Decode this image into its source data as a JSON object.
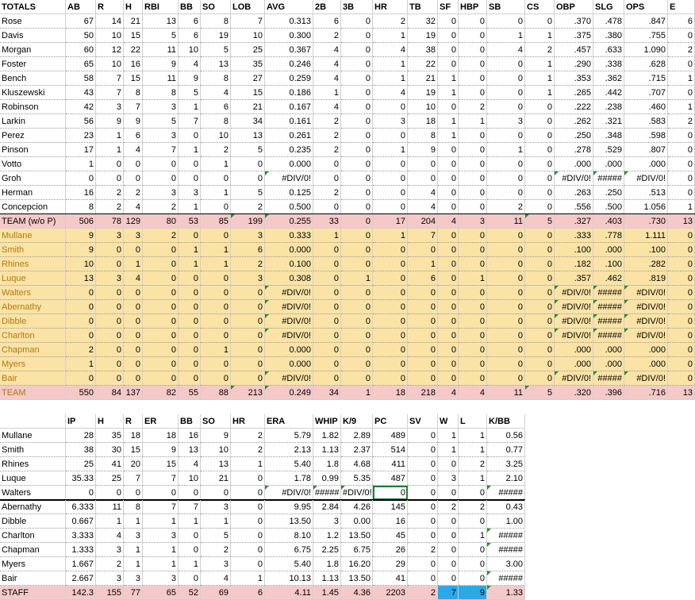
{
  "colors": {
    "team_row": "#f6c9c9",
    "pitcher_row": "#fbe3a6",
    "pitcher_name": "#b07a12",
    "highlight_blue": "#2aa9ea",
    "error_marker": "#2e8b2e"
  },
  "batting": {
    "headers": [
      "TOTALS",
      "AB",
      "R",
      "H",
      "RBI",
      "BB",
      "SO",
      "LOB",
      "AVG",
      "2B",
      "3B",
      "HR",
      "TB",
      "SF",
      "HBP",
      "SB",
      "CS",
      "OBP",
      "SLG",
      "OPS",
      "E"
    ],
    "rows": [
      [
        "Rose",
        "67",
        "14",
        "21",
        "13",
        "6",
        "8",
        "7",
        "0.313",
        "6",
        "0",
        "2",
        "32",
        "0",
        "0",
        "0",
        "0",
        ".370",
        ".478",
        ".847",
        "6"
      ],
      [
        "Davis",
        "50",
        "10",
        "15",
        "5",
        "6",
        "19",
        "10",
        "0.300",
        "2",
        "0",
        "1",
        "19",
        "0",
        "0",
        "1",
        "1",
        ".375",
        ".380",
        ".755",
        "0"
      ],
      [
        "Morgan",
        "60",
        "12",
        "22",
        "11",
        "10",
        "5",
        "25",
        "0.367",
        "4",
        "0",
        "4",
        "38",
        "0",
        "0",
        "4",
        "2",
        ".457",
        ".633",
        "1.090",
        "2"
      ],
      [
        "Foster",
        "65",
        "10",
        "16",
        "9",
        "4",
        "13",
        "35",
        "0.246",
        "4",
        "0",
        "1",
        "22",
        "0",
        "0",
        "0",
        "1",
        ".290",
        ".338",
        ".628",
        "0"
      ],
      [
        "Bench",
        "58",
        "7",
        "15",
        "11",
        "9",
        "8",
        "27",
        "0.259",
        "4",
        "0",
        "1",
        "21",
        "1",
        "0",
        "0",
        "1",
        ".353",
        ".362",
        ".715",
        "1"
      ],
      [
        "Kluszewski",
        "43",
        "7",
        "8",
        "8",
        "5",
        "4",
        "15",
        "0.186",
        "1",
        "0",
        "4",
        "19",
        "1",
        "0",
        "0",
        "1",
        ".265",
        ".442",
        ".707",
        "0"
      ],
      [
        "Robinson",
        "42",
        "3",
        "7",
        "3",
        "1",
        "6",
        "21",
        "0.167",
        "4",
        "0",
        "0",
        "10",
        "0",
        "2",
        "0",
        "0",
        ".222",
        ".238",
        ".460",
        "1"
      ],
      [
        "Larkin",
        "56",
        "9",
        "9",
        "5",
        "7",
        "8",
        "34",
        "0.161",
        "2",
        "0",
        "3",
        "18",
        "1",
        "1",
        "3",
        "0",
        ".262",
        ".321",
        ".583",
        "2"
      ],
      [
        "Perez",
        "23",
        "1",
        "6",
        "3",
        "0",
        "10",
        "13",
        "0.261",
        "2",
        "0",
        "0",
        "8",
        "1",
        "0",
        "0",
        "0",
        ".250",
        ".348",
        ".598",
        "0"
      ],
      [
        "Pinson",
        "17",
        "1",
        "4",
        "7",
        "1",
        "2",
        "5",
        "0.235",
        "2",
        "0",
        "1",
        "9",
        "0",
        "0",
        "1",
        "0",
        ".278",
        ".529",
        ".807",
        "0"
      ],
      [
        "Votto",
        "1",
        "0",
        "0",
        "0",
        "0",
        "1",
        "0",
        "0.000",
        "0",
        "0",
        "0",
        "0",
        "0",
        "0",
        "0",
        "0",
        ".000",
        ".000",
        ".000",
        "0"
      ],
      [
        "Groh",
        "0",
        "0",
        "0",
        "0",
        "0",
        "0",
        "0",
        "#DIV/0!",
        "0",
        "0",
        "0",
        "0",
        "0",
        "0",
        "0",
        "0",
        "#DIV/0!",
        "#####",
        "#DIV/0!",
        "0"
      ],
      [
        "Herman",
        "16",
        "2",
        "2",
        "3",
        "3",
        "1",
        "5",
        "0.125",
        "2",
        "0",
        "0",
        "4",
        "0",
        "0",
        "0",
        "0",
        ".263",
        ".250",
        ".513",
        "0"
      ],
      [
        "Concepcion",
        "8",
        "2",
        "4",
        "2",
        "1",
        "0",
        "2",
        "0.500",
        "0",
        "0",
        "0",
        "4",
        "0",
        "0",
        "2",
        "0",
        ".556",
        ".500",
        "1.056",
        "1"
      ]
    ],
    "team_row": [
      "TEAM (w/o P)",
      "506",
      "78",
      "129",
      "80",
      "53",
      "85",
      "199",
      "0.255",
      "33",
      "0",
      "17",
      "204",
      "4",
      "3",
      "11",
      "5",
      ".327",
      ".403",
      ".730",
      "13"
    ],
    "pitcher_rows": [
      [
        "Mullane",
        "9",
        "3",
        "3",
        "2",
        "0",
        "0",
        "3",
        "0.333",
        "1",
        "0",
        "1",
        "7",
        "0",
        "0",
        "0",
        "0",
        ".333",
        ".778",
        "1.111",
        "0"
      ],
      [
        "Smith",
        "9",
        "0",
        "0",
        "0",
        "1",
        "1",
        "6",
        "0.000",
        "0",
        "0",
        "0",
        "0",
        "0",
        "0",
        "0",
        "0",
        ".100",
        ".000",
        ".100",
        "0"
      ],
      [
        "Rhines",
        "10",
        "0",
        "1",
        "0",
        "1",
        "1",
        "2",
        "0.100",
        "0",
        "0",
        "0",
        "1",
        "0",
        "0",
        "0",
        "0",
        ".182",
        ".100",
        ".282",
        "0"
      ],
      [
        "Luque",
        "13",
        "3",
        "4",
        "0",
        "0",
        "0",
        "3",
        "0.308",
        "0",
        "1",
        "0",
        "6",
        "0",
        "1",
        "0",
        "0",
        ".357",
        ".462",
        ".819",
        "0"
      ],
      [
        "Walters",
        "0",
        "0",
        "0",
        "0",
        "0",
        "0",
        "0",
        "#DIV/0!",
        "0",
        "0",
        "0",
        "0",
        "0",
        "0",
        "0",
        "0",
        "#DIV/0!",
        "#####",
        "#DIV/0!",
        "0"
      ],
      [
        "Abernathy",
        "0",
        "0",
        "0",
        "0",
        "0",
        "0",
        "0",
        "#DIV/0!",
        "0",
        "0",
        "0",
        "0",
        "0",
        "0",
        "0",
        "0",
        "#DIV/0!",
        "#####",
        "#DIV/0!",
        "0"
      ],
      [
        "Dibble",
        "0",
        "0",
        "0",
        "0",
        "0",
        "0",
        "0",
        "#DIV/0!",
        "0",
        "0",
        "0",
        "0",
        "0",
        "0",
        "0",
        "0",
        "#DIV/0!",
        "#####",
        "#DIV/0!",
        "0"
      ],
      [
        "Charlton",
        "0",
        "0",
        "0",
        "0",
        "0",
        "0",
        "0",
        "#DIV/0!",
        "0",
        "0",
        "0",
        "0",
        "0",
        "0",
        "0",
        "0",
        "#DIV/0!",
        "#####",
        "#DIV/0!",
        "0"
      ],
      [
        "Chapman",
        "2",
        "0",
        "0",
        "0",
        "0",
        "1",
        "0",
        "0.000",
        "0",
        "0",
        "0",
        "0",
        "0",
        "0",
        "0",
        "0",
        ".000",
        ".000",
        ".000",
        "0"
      ],
      [
        "Myers",
        "1",
        "0",
        "0",
        "0",
        "0",
        "0",
        "0",
        "0.000",
        "0",
        "0",
        "0",
        "0",
        "0",
        "0",
        "0",
        "0",
        ".000",
        ".000",
        ".000",
        "0"
      ],
      [
        "Bair",
        "0",
        "0",
        "0",
        "0",
        "0",
        "0",
        "0",
        "#DIV/0!",
        "0",
        "0",
        "0",
        "0",
        "0",
        "0",
        "0",
        "0",
        "#DIV/0!",
        "#####",
        "#DIV/0!",
        "0"
      ]
    ],
    "total_row": [
      "TEAM",
      "550",
      "84",
      "137",
      "82",
      "55",
      "88",
      "213",
      "0.249",
      "34",
      "1",
      "18",
      "218",
      "4",
      "4",
      "11",
      "5",
      ".320",
      ".396",
      ".716",
      "13"
    ]
  },
  "pitching": {
    "headers": [
      "",
      "IP",
      "H",
      "R",
      "ER",
      "BB",
      "SO",
      "HR",
      "ERA",
      "WHIP",
      "K/9",
      "PC",
      "SV",
      "W",
      "L",
      "K/BB"
    ],
    "starters": [
      [
        "Mullane",
        "28",
        "35",
        "18",
        "18",
        "16",
        "9",
        "2",
        "5.79",
        "1.82",
        "2.89",
        "489",
        "0",
        "1",
        "1",
        "0.56"
      ],
      [
        "Smith",
        "38",
        "30",
        "15",
        "9",
        "13",
        "10",
        "2",
        "2.13",
        "1.13",
        "2.37",
        "514",
        "0",
        "1",
        "1",
        "0.77"
      ],
      [
        "Rhines",
        "25",
        "41",
        "20",
        "15",
        "4",
        "13",
        "1",
        "5.40",
        "1.8",
        "4.68",
        "411",
        "0",
        "0",
        "2",
        "3.25"
      ],
      [
        "Luque",
        "35.33",
        "25",
        "7",
        "7",
        "10",
        "21",
        "0",
        "1.78",
        "0.99",
        "5.35",
        "487",
        "0",
        "3",
        "1",
        "2.10"
      ],
      [
        "Walters",
        "0",
        "0",
        "0",
        "0",
        "0",
        "0",
        "0",
        "#DIV/0!",
        "#####",
        "#DIV/0!",
        "0",
        "0",
        "0",
        "0",
        "#####"
      ]
    ],
    "relievers": [
      [
        "Abernathy",
        "6.333",
        "11",
        "8",
        "7",
        "7",
        "3",
        "0",
        "9.95",
        "2.84",
        "4.26",
        "145",
        "0",
        "2",
        "2",
        "0.43"
      ],
      [
        "Dibble",
        "0.667",
        "1",
        "1",
        "1",
        "1",
        "1",
        "0",
        "13.50",
        "3",
        "0.00",
        "16",
        "0",
        "0",
        "0",
        "1.00"
      ],
      [
        "Charlton",
        "3.333",
        "4",
        "3",
        "3",
        "0",
        "5",
        "0",
        "8.10",
        "1.2",
        "13.50",
        "45",
        "0",
        "0",
        "1",
        "#####"
      ],
      [
        "Chapman",
        "1.333",
        "3",
        "1",
        "1",
        "0",
        "2",
        "0",
        "6.75",
        "2.25",
        "6.75",
        "26",
        "2",
        "0",
        "0",
        "#####"
      ],
      [
        "Myers",
        "1.667",
        "2",
        "1",
        "1",
        "1",
        "3",
        "0",
        "5.40",
        "1.8",
        "16.20",
        "29",
        "0",
        "0",
        "0",
        "3.00"
      ],
      [
        "Bair",
        "2.667",
        "3",
        "3",
        "3",
        "0",
        "4",
        "1",
        "10.13",
        "1.13",
        "13.50",
        "41",
        "0",
        "0",
        "0",
        "#####"
      ]
    ],
    "staff_row": [
      "STAFF",
      "142.3",
      "155",
      "77",
      "65",
      "52",
      "69",
      "6",
      "4.11",
      "1.45",
      "4.36",
      "2203",
      "2",
      "7",
      "9",
      "1.33"
    ]
  }
}
